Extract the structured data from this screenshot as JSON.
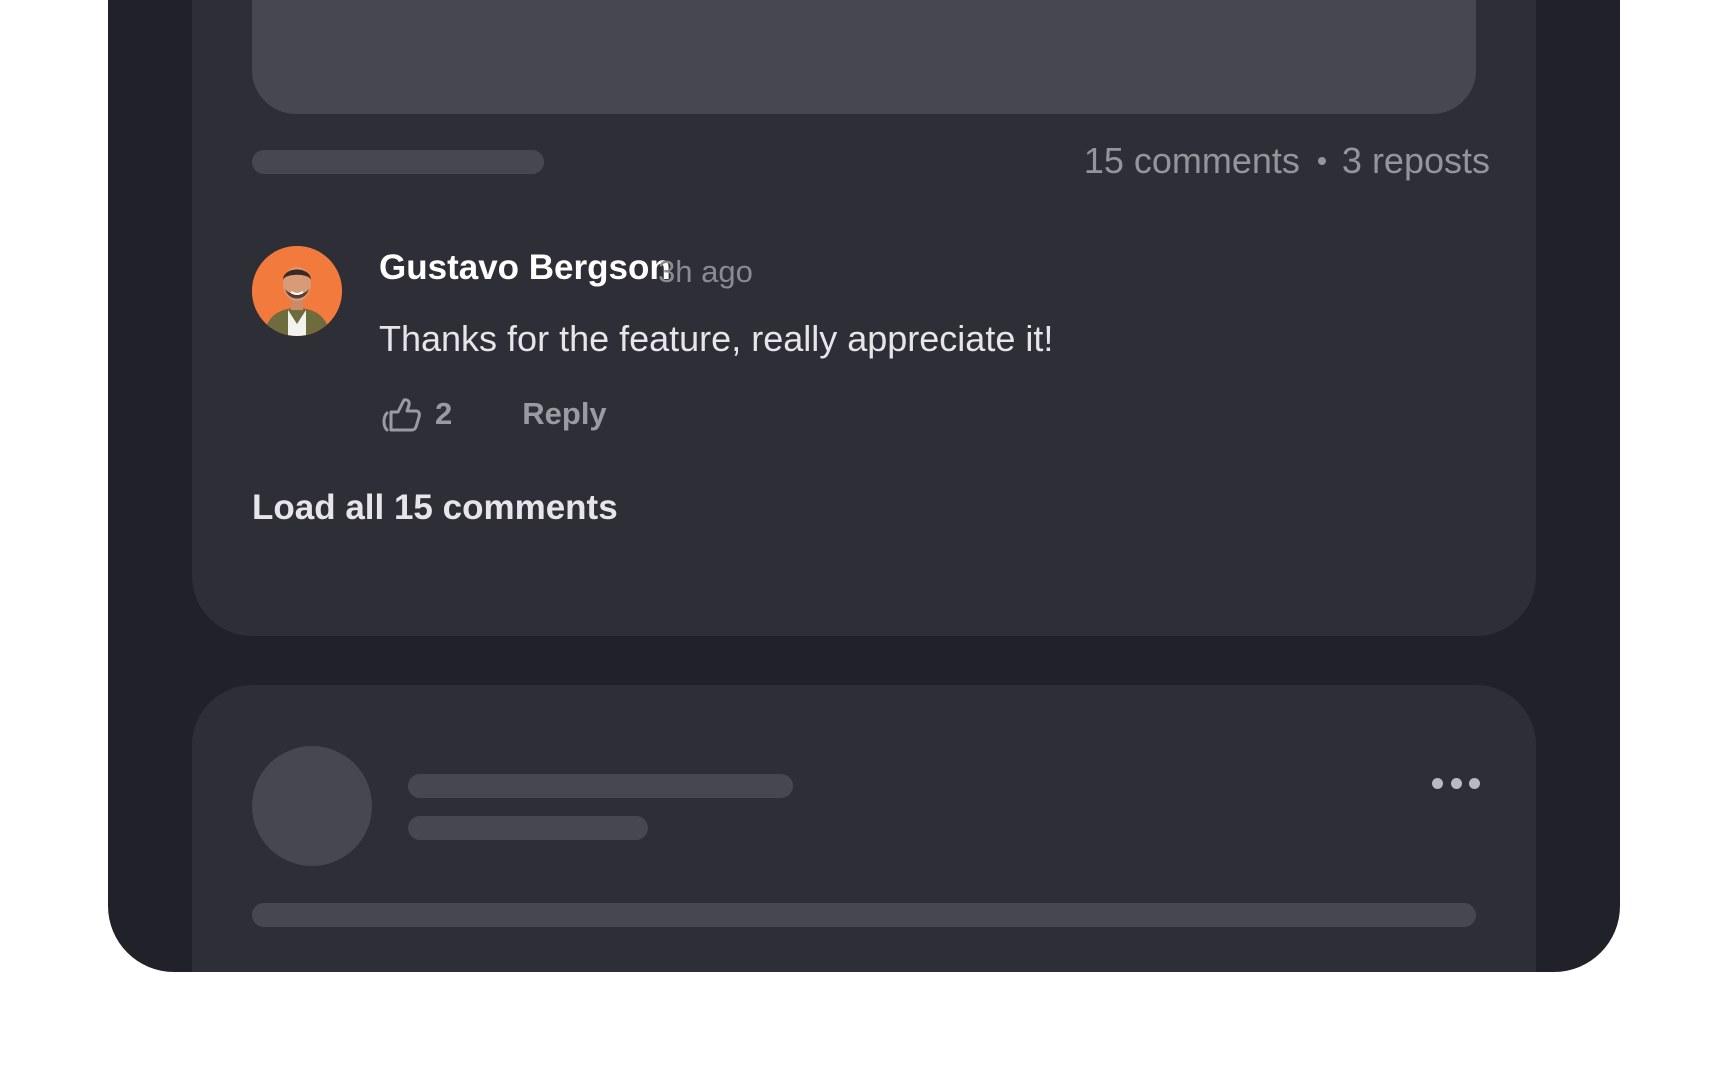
{
  "post": {
    "stats": {
      "comments": "15 comments",
      "reposts": "3 reposts"
    },
    "comment": {
      "author": "Gustavo Bergson",
      "time": "3h ago",
      "text": "Thanks for the feature, really appreciate it!",
      "like_count": "2",
      "reply_label": "Reply"
    },
    "load_all_label": "Load all 15 comments"
  },
  "icons": {
    "like": "thumbs-up-icon",
    "more": "more-horizontal-icon"
  },
  "colors": {
    "background": "#212129",
    "card": "#2e2e36",
    "skeleton": "#474750",
    "avatar_bg": "#f27a3c"
  }
}
